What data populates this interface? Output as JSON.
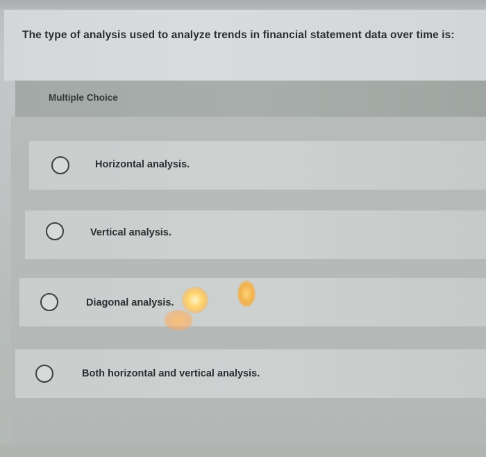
{
  "question": {
    "text": "The type of analysis used to analyze trends in financial statement data over time is:"
  },
  "multiple_choice": {
    "label": "Multiple Choice",
    "choices": [
      {
        "label": "Horizontal analysis.",
        "selected": false
      },
      {
        "label": "Vertical analysis.",
        "selected": false
      },
      {
        "label": "Diagonal analysis.",
        "selected": false
      },
      {
        "label": "Both horizontal and vertical analysis.",
        "selected": false
      }
    ]
  }
}
